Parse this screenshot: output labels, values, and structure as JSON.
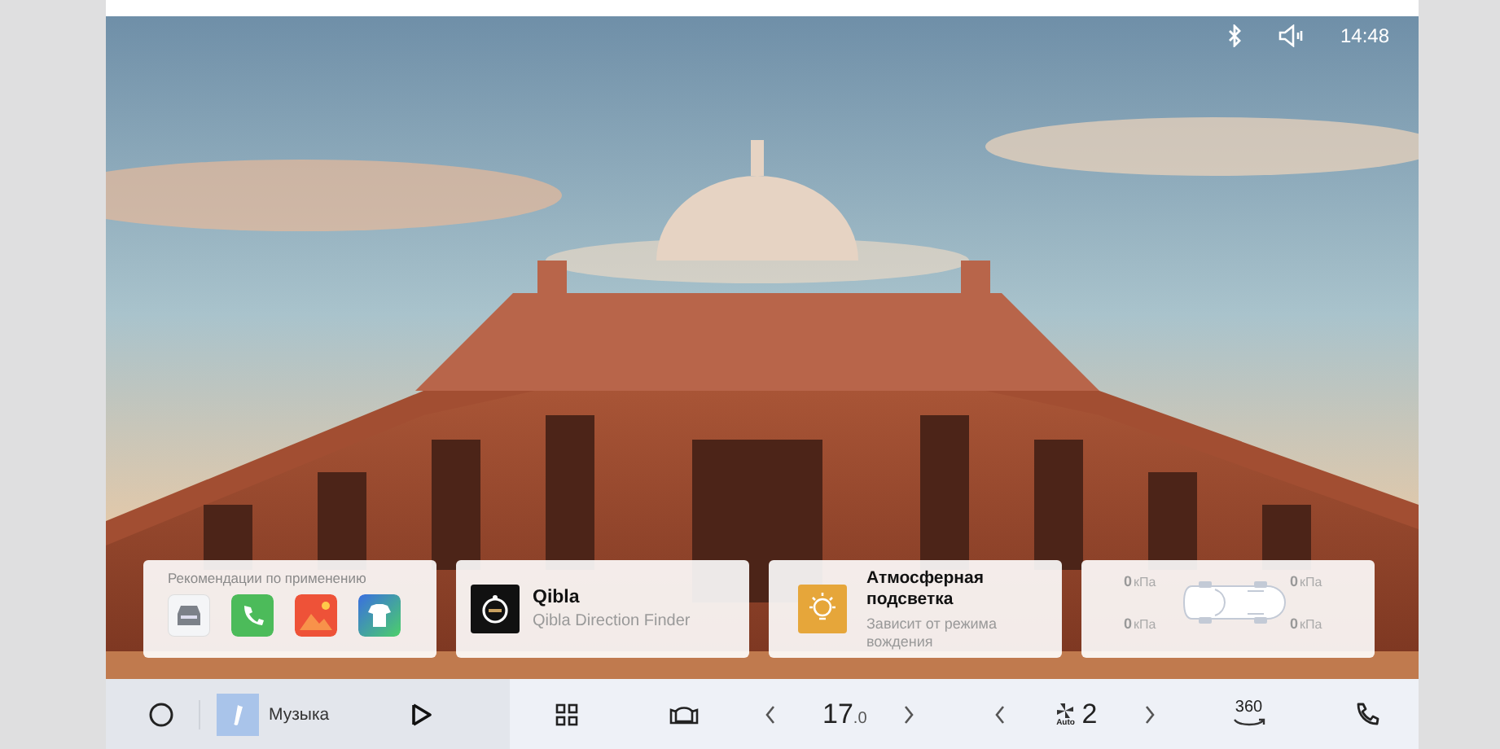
{
  "status_bar": {
    "time": "14:48"
  },
  "recommendations": {
    "title": "Рекомендации по применению"
  },
  "qibla_card": {
    "title": "Qibla",
    "subtitle": "Qibla Direction Finder"
  },
  "ambient_light_card": {
    "title": "Атмосферная подсветка",
    "subtitle": "Зависит от режима вождения"
  },
  "tire_pressure": [
    {
      "value": "0",
      "unit": "кПа"
    },
    {
      "value": "0",
      "unit": "кПа"
    },
    {
      "value": "0",
      "unit": "кПа"
    },
    {
      "value": "0",
      "unit": "кПа"
    }
  ],
  "dock": {
    "music_label": "Музыка",
    "temperature": {
      "value": "17",
      "fraction": ".0"
    },
    "fan": {
      "mode": "Auto",
      "speed": "2"
    },
    "view_label": "360"
  }
}
